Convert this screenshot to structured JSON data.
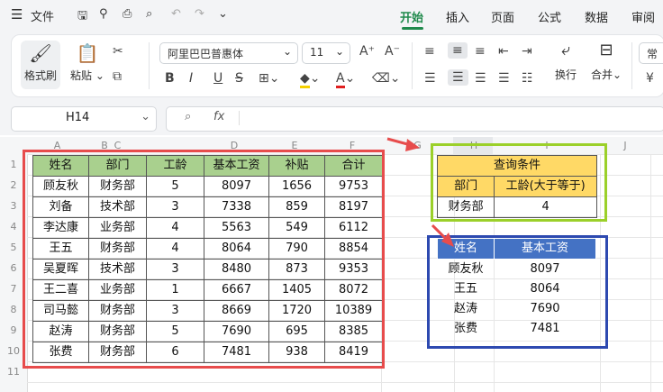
{
  "titlebar": {
    "file_label": "文件",
    "tabs": [
      "开始",
      "插入",
      "页面",
      "公式",
      "数据",
      "审阅"
    ]
  },
  "ribbon": {
    "format_painter": "格式刷",
    "paste": "粘贴",
    "font_name": "阿里巴巴普惠体",
    "font_size": "11",
    "wrap": "换行",
    "merge": "合并",
    "cut_off": "常"
  },
  "formula": {
    "cell_ref": "H14",
    "fx": "fx"
  },
  "columns": [
    "A",
    "B",
    "C",
    "D",
    "E",
    "F",
    "G",
    "H",
    "I",
    "J"
  ],
  "rows": [
    "1",
    "2",
    "3",
    "4",
    "5",
    "6",
    "7",
    "8",
    "9",
    "10",
    "11"
  ],
  "main_table": {
    "headers": [
      "姓名",
      "部门",
      "工龄",
      "基本工资",
      "补贴",
      "合计"
    ],
    "rows": [
      [
        "顾友秋",
        "财务部",
        "5",
        "8097",
        "1656",
        "9753"
      ],
      [
        "刘备",
        "技术部",
        "3",
        "7338",
        "859",
        "8197"
      ],
      [
        "李达康",
        "业务部",
        "4",
        "5563",
        "549",
        "6112"
      ],
      [
        "王五",
        "财务部",
        "4",
        "8064",
        "790",
        "8854"
      ],
      [
        "吴夏晖",
        "技术部",
        "3",
        "8480",
        "873",
        "9353"
      ],
      [
        "王二喜",
        "业务部",
        "1",
        "6667",
        "1405",
        "8072"
      ],
      [
        "司马懿",
        "财务部",
        "3",
        "8669",
        "1720",
        "10389"
      ],
      [
        "赵涛",
        "财务部",
        "5",
        "7690",
        "695",
        "8385"
      ],
      [
        "张费",
        "财务部",
        "6",
        "7481",
        "938",
        "8419"
      ]
    ]
  },
  "query": {
    "title": "查询条件",
    "dept_label": "部门",
    "age_label": "工龄(大于等于)",
    "dept_value": "财务部",
    "age_value": "4"
  },
  "result": {
    "headers": [
      "姓名",
      "基本工资"
    ],
    "rows": [
      [
        "顾友秋",
        "8097"
      ],
      [
        "王五",
        "8064"
      ],
      [
        "赵涛",
        "7690"
      ],
      [
        "张费",
        "7481"
      ]
    ]
  },
  "colors": {
    "header_green": "#a9d08e",
    "query_yellow": "#ffd966",
    "result_blue": "#4472c4",
    "red_box": "#e74c4c",
    "green_box": "#9bd02a",
    "blue_box": "#2d49b0",
    "accent": "#1f8a4c"
  }
}
